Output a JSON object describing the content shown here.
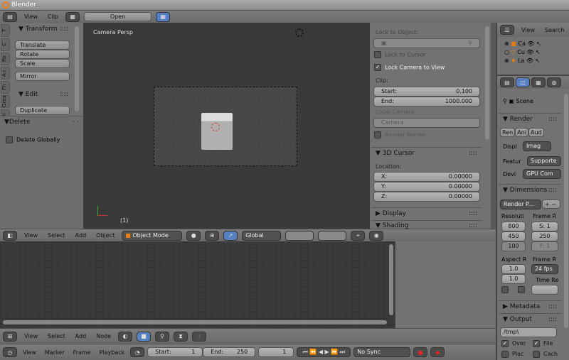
{
  "window": {
    "title": "Blender"
  },
  "top_header": {
    "menus": [
      "View",
      "Clip"
    ],
    "open_label": "Open"
  },
  "toolshelf": {
    "tabs": [
      "T",
      "C",
      "Re",
      "A-i",
      "Fh",
      "Grea",
      "Di"
    ],
    "transform": {
      "title": "Transform",
      "buttons": [
        "Translate",
        "Rotate",
        "Scale",
        "Mirror"
      ]
    },
    "edit": {
      "title": "Edit",
      "buttons": [
        "Duplicate"
      ]
    },
    "operator": {
      "title": "Delete",
      "option": "Delete Globally",
      "checked": false
    }
  },
  "viewport": {
    "label": "Camera Persp",
    "frame_number": "(1)"
  },
  "view_panel": {
    "lock_to_object": "Lock to Object:",
    "lock_to_cursor": "Lock to Cursor",
    "lock_camera": "Lock Camera to View",
    "clip": "Clip:",
    "clip_start_label": "Start:",
    "clip_start": "0.100",
    "clip_end_label": "End:",
    "clip_end": "1000.000",
    "local_camera": "Local Camera:",
    "camera": "Camera",
    "render_border": "Render Border",
    "cursor_title": "3D Cursor",
    "location": "Location:",
    "x_label": "X:",
    "x": "0.00000",
    "y_label": "Y:",
    "y": "0.00000",
    "z_label": "Z:",
    "z": "0.00000",
    "display": "Display",
    "shading": "Shading"
  },
  "outliner": {
    "menus": [
      "View",
      "Search"
    ],
    "items": [
      "Ca",
      "Cu",
      "La"
    ]
  },
  "properties": {
    "scene": "Scene",
    "render_title": "Render",
    "render_buttons": [
      "Ren",
      "Ani",
      "Aud"
    ],
    "display_label": "Displ",
    "display_value": "Imag",
    "feature_label": "Featur",
    "feature_value": "Supporte",
    "device_label": "Devi",
    "device_value": "GPU Com",
    "dimensions_title": "Dimensions",
    "preset": "Render P...",
    "resolution": "Resoluti",
    "res_x": "800",
    "res_y": "450",
    "res_pct": "100",
    "frame_range": "Frame R",
    "frame_start": "S: 1",
    "frame_end": "250",
    "frame_step": "F: 1",
    "aspect": "Aspect R",
    "aspect_x": "1.0",
    "aspect_y": "1.0",
    "frame_rate": "Frame R",
    "fps": "24 fps",
    "time_remap": "Time Re",
    "metadata_title": "Metadata",
    "output_title": "Output",
    "output_path": "/tmp\\",
    "overwrite": "Over",
    "file_ext": "File",
    "placeholders": "Plac",
    "cache": "Cach"
  },
  "view3d_header": {
    "menus": [
      "View",
      "Select",
      "Add",
      "Object"
    ],
    "mode": "Object Mode",
    "orientation": "Global"
  },
  "node_header": {
    "menus": [
      "View",
      "Select",
      "Add",
      "Node"
    ]
  },
  "timeline": {
    "menus": [
      "View",
      "Marker",
      "Frame",
      "Playback"
    ],
    "start_label": "Start:",
    "start": "1",
    "end_label": "End:",
    "end": "250",
    "current": "1",
    "sync": "No Sync"
  }
}
